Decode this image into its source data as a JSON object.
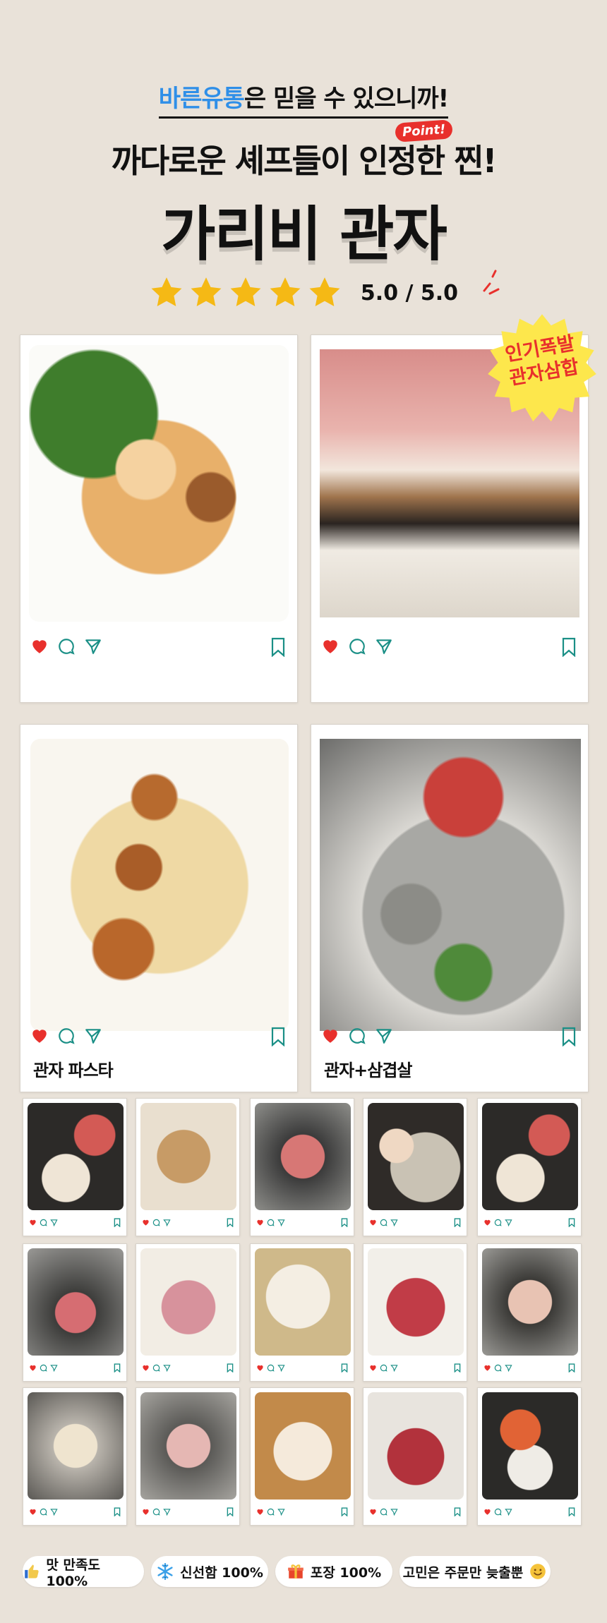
{
  "header": {
    "brand": "바른유통",
    "line1_rest": "은 믿을 수 있으니까!",
    "line2": "까다로운 셰프들이 인정한 찐!",
    "point_badge": "Point!",
    "title": "가리비 관자"
  },
  "rating": {
    "stars": 5,
    "text": "5.0 / 5.0",
    "star_color": "#f5b915"
  },
  "sticker": {
    "line1": "인기폭발",
    "line2": "관자삼합",
    "color": "#fde74c"
  },
  "big_cards": [
    {
      "caption": "",
      "photo": "scallop-pasta-arugula-photo"
    },
    {
      "caption": "",
      "photo": "raw-pork-scallop-platter-photo"
    },
    {
      "caption": "관자 파스타",
      "photo": "scallop-cream-pasta-photo"
    },
    {
      "caption": "관자+삼겹살",
      "photo": "bbq-table-set-photo"
    }
  ],
  "mini_cards": [
    "grill-platter-photo",
    "mushroom-photo",
    "grill-pork-photo",
    "dessert-plate-photo",
    "grill-platter-photo",
    "hotpot-photo",
    "beef-rolls-photo",
    "scallop-close-photo",
    "beef-slices-photo",
    "pork-skewer-photo",
    "scallop-grill-photo",
    "beef-rolls-2-photo",
    "scallop-plate-photo",
    "steak-mushroom-photo",
    "shrimp-grill-photo"
  ],
  "features": [
    {
      "icon": "thumbs-up-icon",
      "text": "맛 만족도 100%"
    },
    {
      "icon": "snowflake-icon",
      "text": "신선함 100%"
    },
    {
      "icon": "gift-icon",
      "text": "포장 100%"
    },
    {
      "icon": "smile-icon",
      "text": "고민은 주문만 늦출뿐"
    }
  ],
  "colors": {
    "background": "#e9e2d9",
    "heart": "#e8302c",
    "accent_icon": "#1a8f86",
    "brand_blue": "#2f8fe8"
  }
}
